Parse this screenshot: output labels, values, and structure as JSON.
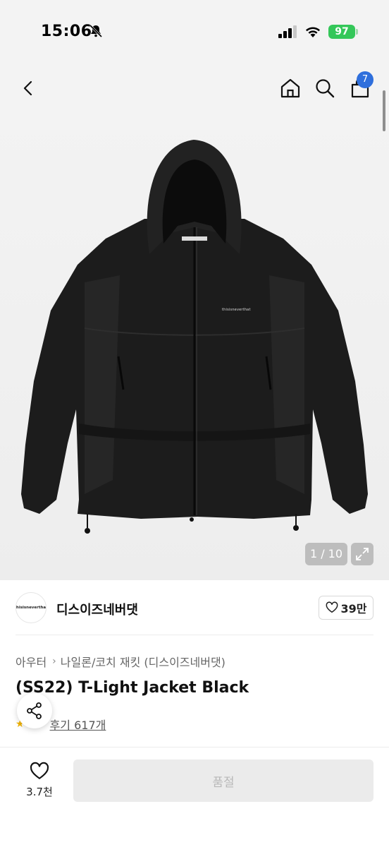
{
  "status_bar": {
    "time": "15:06",
    "battery": "97"
  },
  "nav": {
    "cart_count": "7",
    "icons": [
      "chevron-left-icon",
      "home-icon",
      "search-icon",
      "shopping-bag-icon"
    ]
  },
  "gallery": {
    "page_indicator": "1 / 10",
    "chest_logo_text": "thisisneverthat"
  },
  "brand": {
    "logo_text": "thisisneverthat",
    "name": "디스이즈네버댓",
    "follow_count": "39만"
  },
  "product": {
    "breadcrumb": [
      "아우터",
      "나일론/코치 재킷 (디스이즈네버댓)"
    ],
    "title": "(SS22) T-Light Jacket Black",
    "review_link": "후기 617개"
  },
  "bottom_bar": {
    "like_count": "3.7천",
    "soldout_label": "품절"
  },
  "colors": {
    "accent": "#2f6fdc",
    "battery": "#34c759",
    "rating_star": "#f2b400",
    "disabled_bg": "#ebebeb"
  }
}
